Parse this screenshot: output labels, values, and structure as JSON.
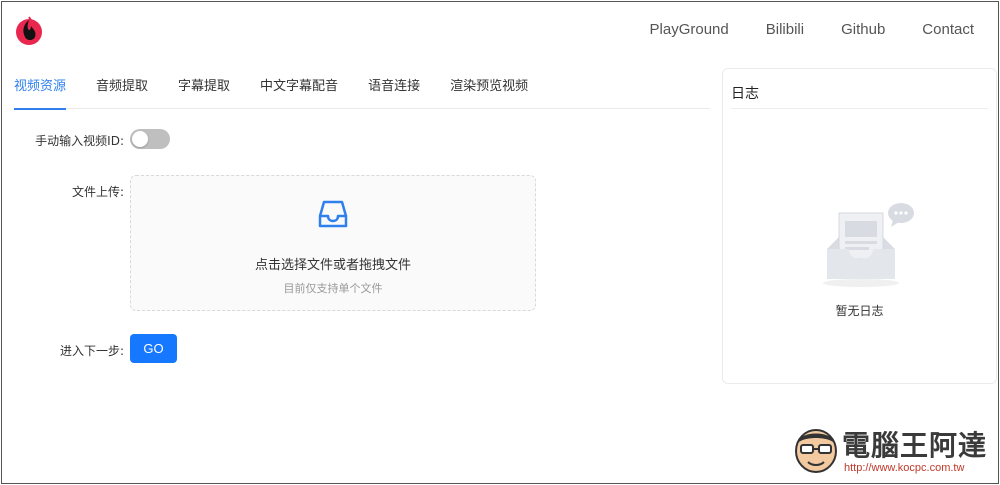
{
  "header": {
    "nav": [
      "PlayGround",
      "Bilibili",
      "Github",
      "Contact"
    ],
    "logo_icon": "flame-logo-icon"
  },
  "tabs": [
    {
      "label": "视频资源",
      "active": true
    },
    {
      "label": "音频提取",
      "active": false
    },
    {
      "label": "字幕提取",
      "active": false
    },
    {
      "label": "中文字幕配音",
      "active": false
    },
    {
      "label": "语音连接",
      "active": false
    },
    {
      "label": "渲染预览视频",
      "active": false
    }
  ],
  "form": {
    "manual_id_label": "手动输入视频ID:",
    "manual_id_on": false,
    "upload_label": "文件上传:",
    "upload_main": "点击选择文件或者拖拽文件",
    "upload_hint": "目前仅支持单个文件",
    "next_label": "进入下一步:",
    "go_button": "GO"
  },
  "log": {
    "title": "日志",
    "empty_text": "暂无日志"
  },
  "watermark": {
    "brand": "電腦王阿達",
    "url": "http://www.kocpc.com.tw"
  },
  "colors": {
    "accent": "#1677ff",
    "tab_active": "#2f80ed",
    "switch_off": "#bfbfbf"
  }
}
